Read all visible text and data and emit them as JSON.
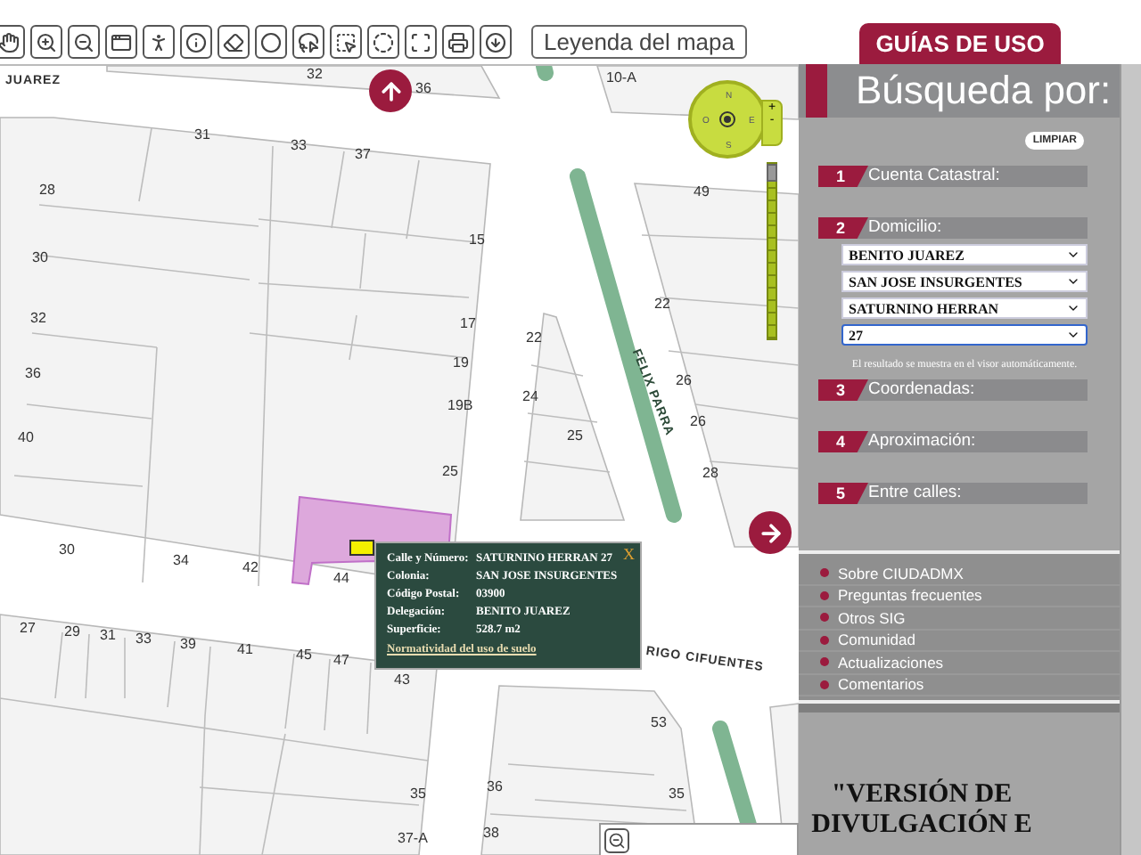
{
  "toolbar": {
    "tools": [
      {
        "kind": "hand"
      },
      {
        "kind": "zoom-in"
      },
      {
        "kind": "zoom-out"
      },
      {
        "kind": "window"
      },
      {
        "kind": "walk"
      },
      {
        "kind": "info"
      },
      {
        "kind": "eraser"
      },
      {
        "kind": "circle"
      },
      {
        "kind": "lasso"
      },
      {
        "kind": "rect-select"
      },
      {
        "kind": "circle-select"
      },
      {
        "kind": "polygon"
      },
      {
        "kind": "print"
      },
      {
        "kind": "download"
      }
    ],
    "legend_button": "Leyenda del mapa"
  },
  "guides_button": "GUÍAS DE USO",
  "map": {
    "labels": [
      {
        "text": "JUAREZ",
        "kind": "street"
      },
      {
        "text": "32",
        "kind": "lot"
      },
      {
        "text": "36",
        "kind": "lot"
      },
      {
        "text": "10-A",
        "kind": "lot"
      },
      {
        "text": "31",
        "kind": "lot"
      },
      {
        "text": "33",
        "kind": "lot"
      },
      {
        "text": "37",
        "kind": "lot"
      },
      {
        "text": "28",
        "kind": "lot"
      },
      {
        "text": "49",
        "kind": "lot"
      },
      {
        "text": "15",
        "kind": "lot"
      },
      {
        "text": "30",
        "kind": "lot"
      },
      {
        "text": "22",
        "kind": "lot"
      },
      {
        "text": "32",
        "kind": "lot"
      },
      {
        "text": "17",
        "kind": "lot"
      },
      {
        "text": "22",
        "kind": "lot"
      },
      {
        "text": "19",
        "kind": "lot"
      },
      {
        "text": "36",
        "kind": "lot"
      },
      {
        "text": "26",
        "kind": "lot"
      },
      {
        "text": "24",
        "kind": "lot"
      },
      {
        "text": "19B",
        "kind": "lot"
      },
      {
        "text": "26",
        "kind": "lot"
      },
      {
        "text": "40",
        "kind": "lot"
      },
      {
        "text": "25",
        "kind": "lot"
      },
      {
        "text": "25",
        "kind": "lot"
      },
      {
        "text": "28",
        "kind": "lot"
      },
      {
        "text": "FELIX PARRA",
        "kind": "street"
      },
      {
        "text": "30",
        "kind": "lot"
      },
      {
        "text": "34",
        "kind": "lot"
      },
      {
        "text": "42",
        "kind": "lot"
      },
      {
        "text": "44",
        "kind": "lot"
      },
      {
        "text": "27",
        "kind": "lot"
      },
      {
        "text": "29",
        "kind": "lot"
      },
      {
        "text": "31",
        "kind": "lot"
      },
      {
        "text": "33",
        "kind": "lot"
      },
      {
        "text": "39",
        "kind": "lot"
      },
      {
        "text": "41",
        "kind": "lot"
      },
      {
        "text": "45",
        "kind": "lot"
      },
      {
        "text": "47",
        "kind": "lot"
      },
      {
        "text": "43",
        "kind": "lot"
      },
      {
        "text": "RIGO CIFUENTES",
        "kind": "street"
      },
      {
        "text": "53",
        "kind": "lot"
      },
      {
        "text": "35",
        "kind": "lot"
      },
      {
        "text": "36",
        "kind": "lot"
      },
      {
        "text": "35",
        "kind": "lot"
      },
      {
        "text": "37-A",
        "kind": "lot"
      },
      {
        "text": "38",
        "kind": "lot"
      }
    ],
    "zoom_slider": {
      "level": 1
    },
    "compass": {
      "north": "N",
      "south": "S",
      "east": "E",
      "west": "O",
      "zoom_in": "+",
      "zoom_out": "-"
    },
    "popup": {
      "close": "X",
      "rows": [
        {
          "label": "Calle y Número:",
          "value": "SATURNINO HERRAN 27"
        },
        {
          "label": "Colonia:",
          "value": "SAN JOSE INSURGENTES"
        },
        {
          "label": "Código Postal:",
          "value": "03900"
        },
        {
          "label": "Delegación:",
          "value": "BENITO JUAREZ"
        },
        {
          "label": "Superficie:",
          "value": "528.7 m2"
        }
      ],
      "link": "Normatividad del uso de suelo"
    }
  },
  "panel": {
    "title": "Búsqueda por:",
    "clear_button": "LIMPIAR",
    "sections": [
      {
        "number": "1",
        "label": "Cuenta Catastral:"
      },
      {
        "number": "2",
        "label": "Domicilio:",
        "selects": [
          {
            "value": "BENITO JUAREZ",
            "focused": false
          },
          {
            "value": "SAN JOSE INSURGENTES",
            "focused": false
          },
          {
            "value": "SATURNINO HERRAN",
            "focused": false
          },
          {
            "value": "27",
            "focused": true
          }
        ],
        "note": "El resultado se muestra en el visor automáticamente."
      },
      {
        "number": "3",
        "label": "Coordenadas:"
      },
      {
        "number": "4",
        "label": "Aproximación:"
      },
      {
        "number": "5",
        "label": "Entre calles:"
      }
    ],
    "links": [
      "Sobre CIUDADMX",
      "Preguntas frecuentes",
      "Otros SIG",
      "Comunidad",
      "Actualizaciones",
      "Comentarios"
    ],
    "notice": "\"VERSIÓN DE DIVULGACIÓN E"
  }
}
